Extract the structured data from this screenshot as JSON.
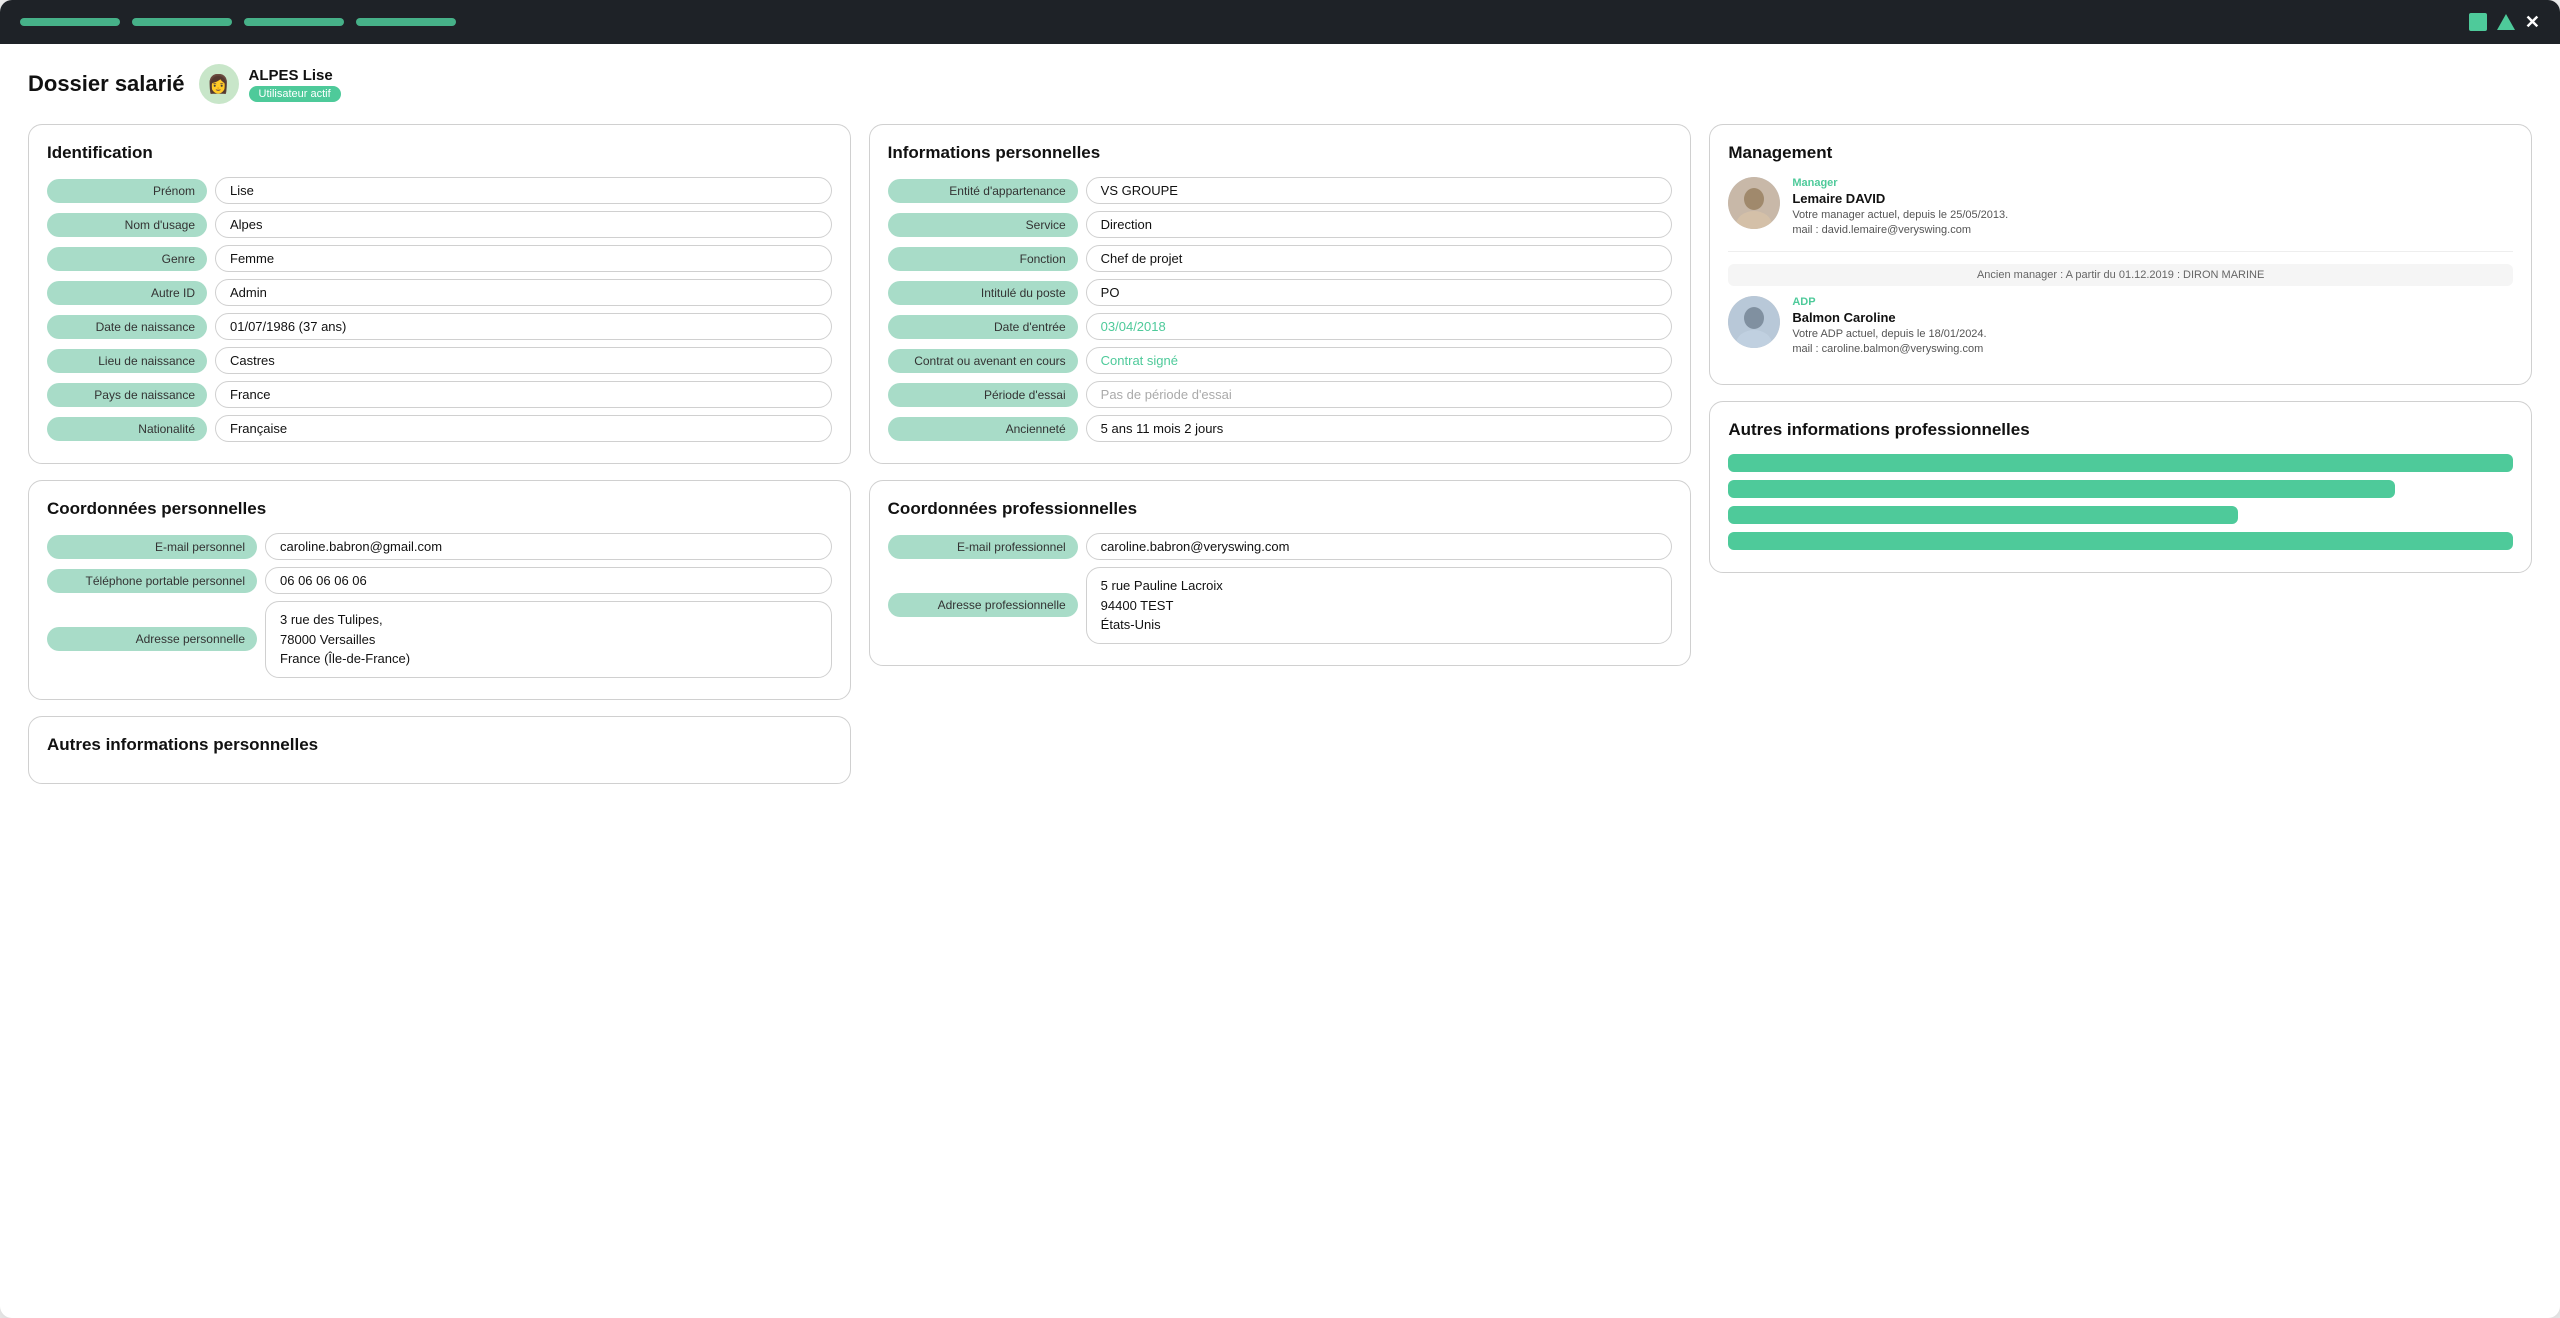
{
  "window": {
    "titlebar": {
      "tabs": [
        "",
        "",
        "",
        ""
      ],
      "controls": [
        "square",
        "triangle",
        "close"
      ]
    }
  },
  "header": {
    "page_title": "Dossier salarié",
    "user_name": "ALPES Lise",
    "user_badge": "Utilisateur actif",
    "avatar_emoji": "👩"
  },
  "identification": {
    "title": "Identification",
    "fields": [
      {
        "label": "Prénom",
        "value": "Lise"
      },
      {
        "label": "Nom d'usage",
        "value": "Alpes"
      },
      {
        "label": "Genre",
        "value": "Femme"
      },
      {
        "label": "Autre ID",
        "value": "Admin"
      },
      {
        "label": "Date de naissance",
        "value": "01/07/1986 (37 ans)"
      },
      {
        "label": "Lieu de naissance",
        "value": "Castres"
      },
      {
        "label": "Pays de naissance",
        "value": "France"
      },
      {
        "label": "Nationalité",
        "value": "Française"
      }
    ]
  },
  "coordonnees_personnelles": {
    "title": "Coordonnées personnelles",
    "fields": [
      {
        "label": "E-mail personnel",
        "value": "caroline.babron@gmail.com"
      },
      {
        "label": "Téléphone portable personnel",
        "value": "06 06 06 06 06"
      },
      {
        "label": "Adresse personnelle",
        "value": "3 rue des Tulipes,\n78000 Versailles\nFrance (Île-de-France)",
        "multiline": true
      }
    ]
  },
  "autres_informations_personnelles": {
    "title": "Autres informations personnelles"
  },
  "informations_personnelles": {
    "title": "Informations personnelles",
    "fields": [
      {
        "label": "Entité d'appartenance",
        "value": "VS GROUPE",
        "style": "normal"
      },
      {
        "label": "Service",
        "value": "Direction",
        "style": "normal"
      },
      {
        "label": "Fonction",
        "value": "Chef de projet",
        "style": "normal"
      },
      {
        "label": "Intitulé du poste",
        "value": "PO",
        "style": "normal"
      },
      {
        "label": "Date d'entrée",
        "value": "03/04/2018",
        "style": "teal"
      },
      {
        "label": "Contrat ou avenant en cours",
        "value": "Contrat signé",
        "style": "link"
      },
      {
        "label": "Période d'essai",
        "value": "Pas de période d'essai",
        "style": "muted"
      },
      {
        "label": "Ancienneté",
        "value": "5 ans 11 mois 2 jours",
        "style": "normal"
      }
    ]
  },
  "coordonnees_professionnelles": {
    "title": "Coordonnées professionnelles",
    "fields": [
      {
        "label": "E-mail professionnel",
        "value": "caroline.babron@veryswing.com"
      },
      {
        "label": "Adresse professionnelle",
        "value": "5 rue Pauline Lacroix\n94400 TEST\nÉtats-Unis",
        "multiline": true
      }
    ]
  },
  "management": {
    "title": "Management",
    "managers": [
      {
        "role": "Manager",
        "name": "Lemaire DAVID",
        "desc_line1": "Votre manager actuel, depuis le 25/05/2013.",
        "desc_line2": "mail : david.lemaire@veryswing.com",
        "emoji": "👨"
      },
      {
        "role": "ADP",
        "name": "Balmon Caroline",
        "desc_line1": "Votre ADP actuel, depuis le 18/01/2024.",
        "desc_line2": "mail : caroline.balmon@veryswing.com",
        "emoji": "👨"
      }
    ],
    "old_manager": "Ancien manager : A partir du 01.12.2019 : DIRON MARINE"
  },
  "autres_informations_professionnelles": {
    "title": "Autres informations professionnelles",
    "bars": [
      {
        "width": "100%"
      },
      {
        "width": "85%"
      },
      {
        "width": "65%"
      },
      {
        "width": "100%"
      }
    ]
  }
}
